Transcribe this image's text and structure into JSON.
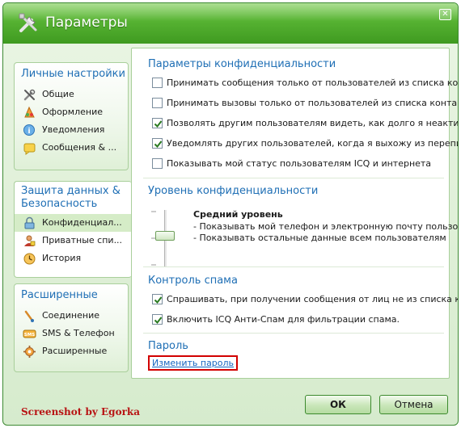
{
  "window": {
    "title": "Параметры",
    "close": "✕"
  },
  "sidebar": {
    "groups": [
      {
        "heading": "Личные настройки",
        "items": [
          {
            "label": "Общие",
            "icon": "tools-icon"
          },
          {
            "label": "Оформление",
            "icon": "palette-icon"
          },
          {
            "label": "Уведомления",
            "icon": "notification-icon"
          },
          {
            "label": "Сообщения & ...",
            "icon": "message-icon"
          }
        ]
      },
      {
        "heading_line1": "Защита данных &",
        "heading_line2": "Безопасность",
        "items": [
          {
            "label": "Конфиденциал...",
            "icon": "lock-icon",
            "selected": true
          },
          {
            "label": "Приватные спи...",
            "icon": "private-list-icon"
          },
          {
            "label": "История",
            "icon": "history-icon"
          }
        ]
      },
      {
        "heading": "Расширенные",
        "items": [
          {
            "label": "Соединение",
            "icon": "connection-icon"
          },
          {
            "label": "SMS & Телефон",
            "icon": "sms-icon"
          },
          {
            "label": "Расширенные",
            "icon": "gear-icon"
          }
        ]
      }
    ]
  },
  "privacy": {
    "title": "Параметры конфиденциальности",
    "options": [
      {
        "label": "Принимать сообщения только от пользователей из списка конт...",
        "checked": false
      },
      {
        "label": "Принимать вызовы только от пользователей из списка контактов",
        "checked": false
      },
      {
        "label": "Позволять другим пользователям видеть, как долго я неактивен",
        "checked": true
      },
      {
        "label": "Уведомлять других пользователей, когда я выхожу из переписки",
        "checked": true
      },
      {
        "label": "Показывать мой статус пользователям ICQ и интернета",
        "checked": false
      }
    ]
  },
  "level": {
    "title": "Уровень конфиденциальности",
    "name": "Средний уровень",
    "desc1": "- Показывать мой телефон и электронную почту пользова...",
    "desc2": "- Показывать остальные данные всем пользователям",
    "position": "middle"
  },
  "spam": {
    "title": "Контроль спама",
    "options": [
      {
        "label": "Спрашивать, при получении сообщения от лиц не из списка кон...",
        "checked": true
      },
      {
        "label": "Включить ICQ Анти-Спам для фильтрации спама.",
        "checked": true
      }
    ]
  },
  "password": {
    "title": "Пароль",
    "change_link": "Изменить пароль"
  },
  "footer": {
    "watermark": "Screenshot by Egorka",
    "ok": "ОК",
    "cancel": "Отмена"
  },
  "colors": {
    "accent": "#1f6fb5",
    "brand": "#56b232",
    "highlight": "#d20000"
  }
}
